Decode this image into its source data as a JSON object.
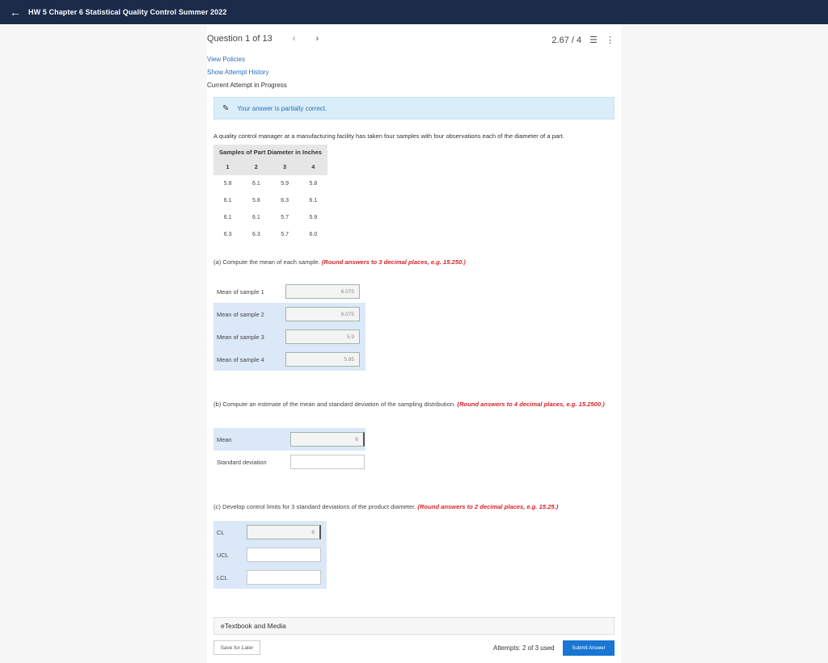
{
  "header": {
    "title": "HW 5 Chapter 6 Statistical Quality Control Summer 2022"
  },
  "question_nav": {
    "label": "Question 1 of 13",
    "score": "2.67 / 4"
  },
  "links": {
    "view_policies": "View Policies",
    "show_attempt_history": "Show Attempt History"
  },
  "attempt_status": "Current Attempt in Progress",
  "feedback": "Your answer is partially correct.",
  "problem_text": "A quality control manager at a manufacturing facility has taken four samples with four observations each of the diameter of a part.",
  "samples_table": {
    "title": "Samples of Part Diameter in Inches",
    "headers": [
      "1",
      "2",
      "3",
      "4"
    ],
    "rows": [
      [
        "5.8",
        "6.1",
        "5.9",
        "5.8"
      ],
      [
        "6.1",
        "5.8",
        "6.3",
        "6.1"
      ],
      [
        "6.1",
        "6.1",
        "5.7",
        "5.9"
      ],
      [
        "6.3",
        "6.3",
        "5.7",
        "6.0"
      ]
    ]
  },
  "part_a": {
    "prompt": "(a) Compute the mean of each sample.",
    "round_note": "(Round answers to 3 decimal places, e.g. 15.250.)",
    "fields": [
      {
        "label": "Mean of sample 1",
        "value": "6.075"
      },
      {
        "label": "Mean of sample 2",
        "value": "6.075"
      },
      {
        "label": "Mean of sample 3",
        "value": "5.9"
      },
      {
        "label": "Mean of sample 4",
        "value": "5.95"
      }
    ]
  },
  "part_b": {
    "prompt": "(b) Compute an estimate of the mean and standard deviation of the sampling distribution.",
    "round_note": "(Round answers to 4 decimal places, e.g. 15.2500.)",
    "fields": [
      {
        "label": "Mean",
        "value": "6"
      },
      {
        "label": "Standard deviation",
        "value": ""
      }
    ]
  },
  "part_c": {
    "prompt": "(c) Develop control limits for 3 standard deviations of the product diameter.",
    "round_note": "(Round answers to 2 decimal places, e.g. 15.25.)",
    "fields": [
      {
        "label": "CL",
        "value": "6"
      },
      {
        "label": "UCL",
        "value": ""
      },
      {
        "label": "LCL",
        "value": ""
      }
    ]
  },
  "etextbook": "eTextbook and Media",
  "footer": {
    "save_label": "Save for Later",
    "attempts": "Attempts: 2 of 3 used",
    "submit_label": "Submit Answer"
  },
  "colors": {
    "topbar": "#1c2b4a",
    "link": "#2a6ebb",
    "round_note": "#d8232a",
    "submit": "#1976d2",
    "row_highlight": "#dbe8f8",
    "banner": "#d9eef8"
  }
}
